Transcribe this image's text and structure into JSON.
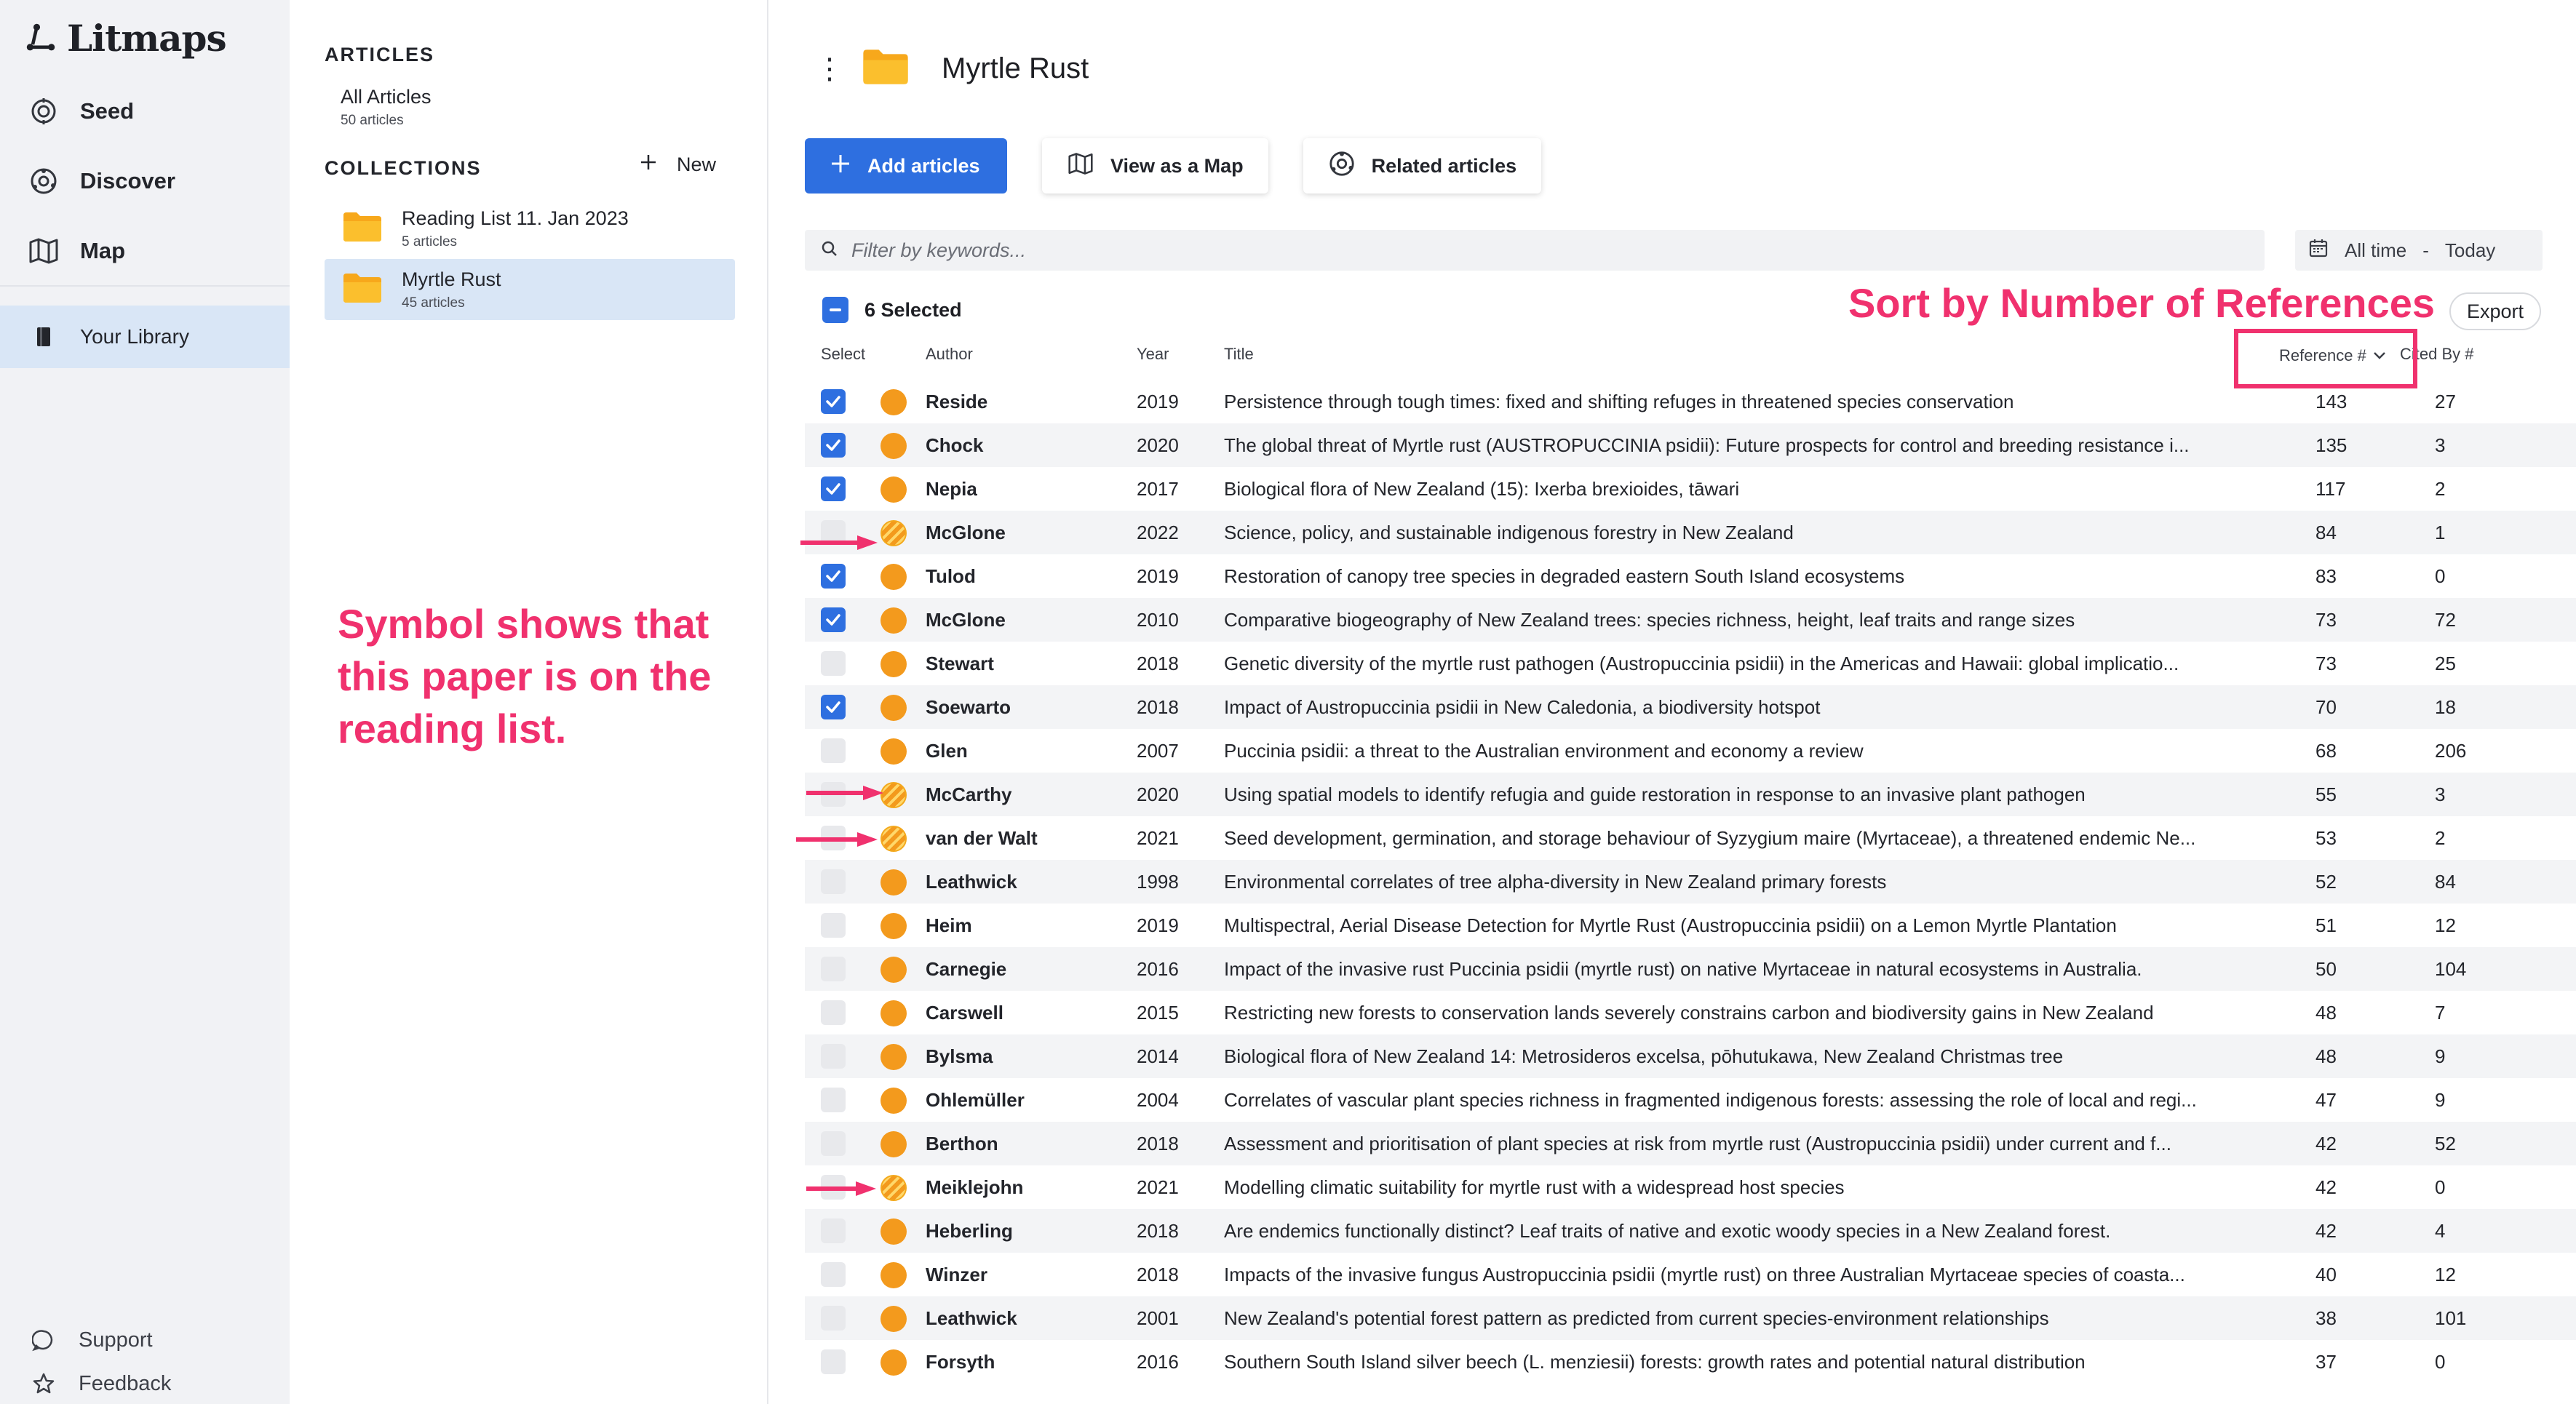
{
  "app": {
    "logo": "Litmaps",
    "nav": [
      {
        "label": "Seed",
        "icon": "seed-icon"
      },
      {
        "label": "Discover",
        "icon": "discover-icon"
      },
      {
        "label": "Map",
        "icon": "map-icon"
      }
    ],
    "library_label": "Your Library",
    "support_label": "Support",
    "feedback_label": "Feedback"
  },
  "panel": {
    "articles_heading": "ARTICLES",
    "all_articles": {
      "title": "All Articles",
      "count": "50 articles"
    },
    "collections_heading": "COLLECTIONS",
    "new_label": "New",
    "collections": [
      {
        "title": "Reading List 11. Jan 2023",
        "count": "5 articles",
        "active": false
      },
      {
        "title": "Myrtle Rust",
        "count": "45 articles",
        "active": true
      }
    ]
  },
  "main": {
    "title": "Myrtle Rust",
    "buttons": {
      "add": "Add articles",
      "map": "View as a Map",
      "related": "Related articles"
    },
    "filter_placeholder": "Filter by keywords...",
    "date_from": "All time",
    "date_sep": "-",
    "date_to": "Today",
    "selected_label": "6 Selected",
    "export_label": "Export",
    "columns": {
      "select": "Select",
      "author": "Author",
      "year": "Year",
      "title": "Title",
      "references": "Reference #",
      "cited_by": "Cited By #"
    }
  },
  "annotations": {
    "sort_note": "Sort by Number of References",
    "symbol_note": "Symbol shows that this paper is on the reading list."
  },
  "colors": {
    "accent": "#2e6fe0",
    "dot": "#f39a1d",
    "annotation": "#f0316e",
    "selected_bg": "#d9e6f6"
  },
  "rows": [
    {
      "checked": true,
      "reading": false,
      "author": "Reside",
      "year": "2019",
      "title": "Persistence through tough times: fixed and shifting refuges in threatened species conservation",
      "refs": "143",
      "cited": "27"
    },
    {
      "checked": true,
      "reading": false,
      "author": "Chock",
      "year": "2020",
      "title": "The global threat of Myrtle rust (AUSTROPUCCINIA psidii): Future prospects for control and breeding resistance i...",
      "refs": "135",
      "cited": "3"
    },
    {
      "checked": true,
      "reading": false,
      "author": "Nepia",
      "year": "2017",
      "title": "Biological flora of New Zealand (15): Ixerba brexioides, tāwari",
      "refs": "117",
      "cited": "2"
    },
    {
      "checked": false,
      "reading": true,
      "author": "McGlone",
      "year": "2022",
      "title": "Science, policy, and sustainable indigenous forestry in New Zealand",
      "refs": "84",
      "cited": "1"
    },
    {
      "checked": true,
      "reading": false,
      "author": "Tulod",
      "year": "2019",
      "title": "Restoration of canopy tree species in degraded eastern South Island ecosystems",
      "refs": "83",
      "cited": "0"
    },
    {
      "checked": true,
      "reading": false,
      "author": "McGlone",
      "year": "2010",
      "title": "Comparative biogeography of New Zealand trees: species richness, height, leaf traits and range sizes",
      "refs": "73",
      "cited": "72"
    },
    {
      "checked": false,
      "reading": false,
      "author": "Stewart",
      "year": "2018",
      "title": "Genetic diversity of the myrtle rust pathogen (Austropuccinia psidii) in the Americas and Hawaii: global implicatio...",
      "refs": "73",
      "cited": "25"
    },
    {
      "checked": true,
      "reading": false,
      "author": "Soewarto",
      "year": "2018",
      "title": "Impact of Austropuccinia psidii in New Caledonia, a biodiversity hotspot",
      "refs": "70",
      "cited": "18"
    },
    {
      "checked": false,
      "reading": false,
      "author": "Glen",
      "year": "2007",
      "title": "Puccinia psidii: a threat to the Australian environment and economy a review",
      "refs": "68",
      "cited": "206"
    },
    {
      "checked": false,
      "reading": true,
      "author": "McCarthy",
      "year": "2020",
      "title": "Using spatial models to identify refugia and guide restoration in response to an invasive plant pathogen",
      "refs": "55",
      "cited": "3"
    },
    {
      "checked": false,
      "reading": true,
      "author": "van der Walt",
      "year": "2021",
      "title": "Seed development, germination, and storage behaviour of Syzygium maire (Myrtaceae), a threatened endemic Ne...",
      "refs": "53",
      "cited": "2"
    },
    {
      "checked": false,
      "reading": false,
      "author": "Leathwick",
      "year": "1998",
      "title": "Environmental correlates of tree alpha-diversity in New Zealand primary forests",
      "refs": "52",
      "cited": "84"
    },
    {
      "checked": false,
      "reading": false,
      "author": "Heim",
      "year": "2019",
      "title": "Multispectral, Aerial Disease Detection for Myrtle Rust (Austropuccinia psidii) on a Lemon Myrtle Plantation",
      "refs": "51",
      "cited": "12"
    },
    {
      "checked": false,
      "reading": false,
      "author": "Carnegie",
      "year": "2016",
      "title": "Impact of the invasive rust Puccinia psidii (myrtle rust) on native Myrtaceae in natural ecosystems in Australia.",
      "refs": "50",
      "cited": "104"
    },
    {
      "checked": false,
      "reading": false,
      "author": "Carswell",
      "year": "2015",
      "title": "Restricting new forests to conservation lands severely constrains carbon and biodiversity gains in New Zealand",
      "refs": "48",
      "cited": "7"
    },
    {
      "checked": false,
      "reading": false,
      "author": "Bylsma",
      "year": "2014",
      "title": "Biological flora of New Zealand 14: Metrosideros excelsa, pōhutukawa, New Zealand Christmas tree",
      "refs": "48",
      "cited": "9"
    },
    {
      "checked": false,
      "reading": false,
      "author": "Ohlemüller",
      "year": "2004",
      "title": "Correlates of vascular plant species richness in fragmented indigenous forests: assessing the role of local and regi...",
      "refs": "47",
      "cited": "9"
    },
    {
      "checked": false,
      "reading": false,
      "author": "Berthon",
      "year": "2018",
      "title": "Assessment and prioritisation of plant species at risk from myrtle rust (Austropuccinia psidii) under current and f...",
      "refs": "42",
      "cited": "52"
    },
    {
      "checked": false,
      "reading": true,
      "author": "Meiklejohn",
      "year": "2021",
      "title": "Modelling climatic suitability for myrtle rust with a widespread host species",
      "refs": "42",
      "cited": "0"
    },
    {
      "checked": false,
      "reading": false,
      "author": "Heberling",
      "year": "2018",
      "title": "Are endemics functionally distinct? Leaf traits of native and exotic woody species in a New Zealand forest.",
      "refs": "42",
      "cited": "4"
    },
    {
      "checked": false,
      "reading": false,
      "author": "Winzer",
      "year": "2018",
      "title": "Impacts of the invasive fungus Austropuccinia psidii (myrtle rust) on three Australian Myrtaceae species of coasta...",
      "refs": "40",
      "cited": "12"
    },
    {
      "checked": false,
      "reading": false,
      "author": "Leathwick",
      "year": "2001",
      "title": "New Zealand's potential forest pattern as predicted from current species-environment relationships",
      "refs": "38",
      "cited": "101"
    },
    {
      "checked": false,
      "reading": false,
      "author": "Forsyth",
      "year": "2016",
      "title": "Southern South Island silver beech (L. menziesii) forests: growth rates and potential natural distribution",
      "refs": "37",
      "cited": "0"
    }
  ]
}
